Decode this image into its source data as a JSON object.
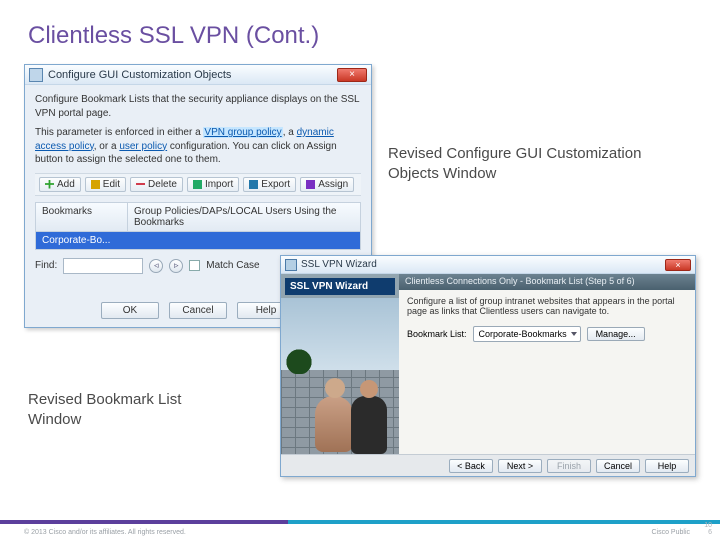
{
  "slide": {
    "title": "Clientless SSL VPN (Cont.)",
    "caption_config": "Revised Configure GUI Customization Objects Window",
    "caption_bookmark": "Revised Bookmark List Window",
    "copyright": "© 2013 Cisco and/or its affiliates. All rights reserved.",
    "cisco_public": "Cisco Public",
    "page_small": "10",
    "page_large": "6"
  },
  "dialog1": {
    "title": "Configure GUI Customization Objects",
    "close": "×",
    "desc1": "Configure Bookmark Lists that the security appliance displays on the SSL VPN portal page.",
    "desc2_pre": "This parameter is enforced in either a ",
    "link1": "VPN group policy",
    "desc2_mid1": ", a ",
    "link2": "dynamic access policy",
    "desc2_mid2": ", or a ",
    "link3": "user policy",
    "desc2_post": " configuration. You can click on Assign button to assign the selected one to them.",
    "toolbar": {
      "add": "Add",
      "edit": "Edit",
      "delete": "Delete",
      "import": "Import",
      "export": "Export",
      "assign": "Assign"
    },
    "headers": {
      "c1": "Bookmarks",
      "c2": "Group Policies/DAPs/LOCAL Users Using the Bookmarks"
    },
    "selected": "Corporate-Bo...",
    "find_label": "Find:",
    "nav_prev": "◦",
    "nav_next": "◦",
    "match_case": "Match Case",
    "buttons": {
      "ok": "OK",
      "cancel": "Cancel",
      "help": "Help"
    }
  },
  "dialog2": {
    "title": "SSL VPN Wizard",
    "close": "×",
    "sidebar_label": "SSL VPN Wizard",
    "stepbar": "Clientless Connections Only - Bookmark List  (Step 5 of 6)",
    "desc": "Configure a list of group intranet websites that appears in the portal page as links that Clientless users can navigate to.",
    "bm_label": "Bookmark List:",
    "bm_value": "Corporate-Bookmarks",
    "manage": "Manage...",
    "buttons": {
      "back": "< Back",
      "next": "Next >",
      "finish": "Finish",
      "cancel": "Cancel",
      "help": "Help"
    }
  }
}
